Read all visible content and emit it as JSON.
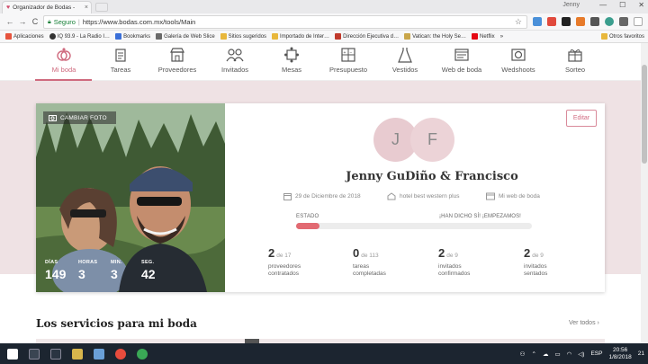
{
  "browser": {
    "tab_title": "Organizador de Bodas - ",
    "tab_close": "×",
    "user": "Jenny",
    "win_min": "—",
    "win_max": "☐",
    "win_close": "✕",
    "back": "←",
    "forward": "→",
    "reload": "C",
    "secure_label": "Seguro",
    "url": "https://www.bodas.com.mx/tools/Main",
    "star": "☆",
    "bookmarks": [
      "Aplicaciones",
      "IQ 93.9 - La Radio I…",
      "Bookmarks",
      "Galería de Web Slice",
      "Sitios sugeridos",
      "Importado de Inter…",
      "Dirección Ejecutiva d…",
      "Vatican: the Holy Se…",
      "Netflix"
    ],
    "bookmarks_more": "»",
    "other_bookmarks": "Otros favoritos"
  },
  "nav": {
    "items": [
      {
        "label": "Mi boda",
        "icon": "heart-ring-icon"
      },
      {
        "label": "Tareas",
        "icon": "clipboard-icon"
      },
      {
        "label": "Proveedores",
        "icon": "store-icon"
      },
      {
        "label": "Invitados",
        "icon": "people-icon"
      },
      {
        "label": "Mesas",
        "icon": "table-icon"
      },
      {
        "label": "Presupuesto",
        "icon": "calculator-icon"
      },
      {
        "label": "Vestidos",
        "icon": "dress-icon"
      },
      {
        "label": "Web de boda",
        "icon": "web-icon"
      },
      {
        "label": "Wedshoots",
        "icon": "camera-icon"
      },
      {
        "label": "Sorteo",
        "icon": "gift-icon"
      }
    ]
  },
  "profile": {
    "change_photo": "CAMBIAR FOTO",
    "countdown": [
      {
        "label": "DÍAS",
        "value": "149"
      },
      {
        "label": "HORAS",
        "value": "3"
      },
      {
        "label": "MIN.",
        "value": "3"
      },
      {
        "label": "SEG.",
        "value": "42"
      }
    ],
    "edit": "Editar",
    "initial_1": "J",
    "initial_2": "F",
    "couple_name": "Jenny GuDiño & Francisco",
    "date": "29 de Diciembre de 2018",
    "venue": "hotel best western plus",
    "web": "Mi web de boda",
    "estado_label": "ESTADO",
    "estado_message": "¡HAN DICHO SÍ! ¡EMPEZAMOS!",
    "progress": 0.1,
    "stats": [
      {
        "value": "2",
        "of": "de 17",
        "desc_1": "proveedores",
        "desc_2": "contratados"
      },
      {
        "value": "0",
        "of": "de 113",
        "desc_1": "tareas",
        "desc_2": "completadas"
      },
      {
        "value": "2",
        "of": "de 9",
        "desc_1": "invitados",
        "desc_2": "confirmados"
      },
      {
        "value": "2",
        "of": "de 9",
        "desc_1": "invitados",
        "desc_2": "sentados"
      }
    ]
  },
  "services": {
    "title": "Los servicios para mi boda",
    "see_all": "Ver todos ›"
  },
  "taskbar": {
    "lang": "ESP",
    "time": "20:56",
    "date": "1/8/2018",
    "notifications": "21"
  },
  "colors": {
    "accent": "#cf6a7e",
    "hero_bg": "#efe2e4",
    "progress_fill": "#e26a72",
    "taskbar_bg": "#1c2530"
  }
}
